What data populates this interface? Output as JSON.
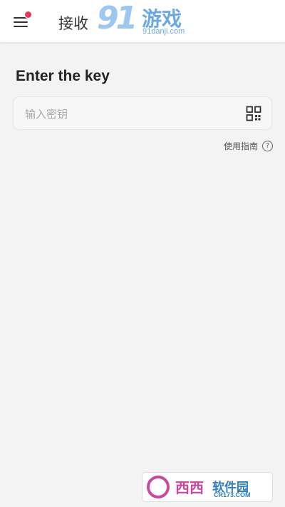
{
  "header": {
    "title": "接收"
  },
  "watermark_top": {
    "number": "91",
    "text": "游戏",
    "url": "91danji.com"
  },
  "main": {
    "heading": "Enter the key",
    "key_input": {
      "value": "",
      "placeholder": "输入密钥"
    },
    "guide_label": "使用指南",
    "help_icon": "?"
  },
  "watermark_bottom": {
    "brand": "西西",
    "text": "软件园",
    "url": "CR173.COM"
  },
  "colors": {
    "accent_dot": "#e23b55",
    "background": "#f3f3f3"
  },
  "icons": [
    "menu-icon",
    "qr-code-icon",
    "help-icon"
  ]
}
